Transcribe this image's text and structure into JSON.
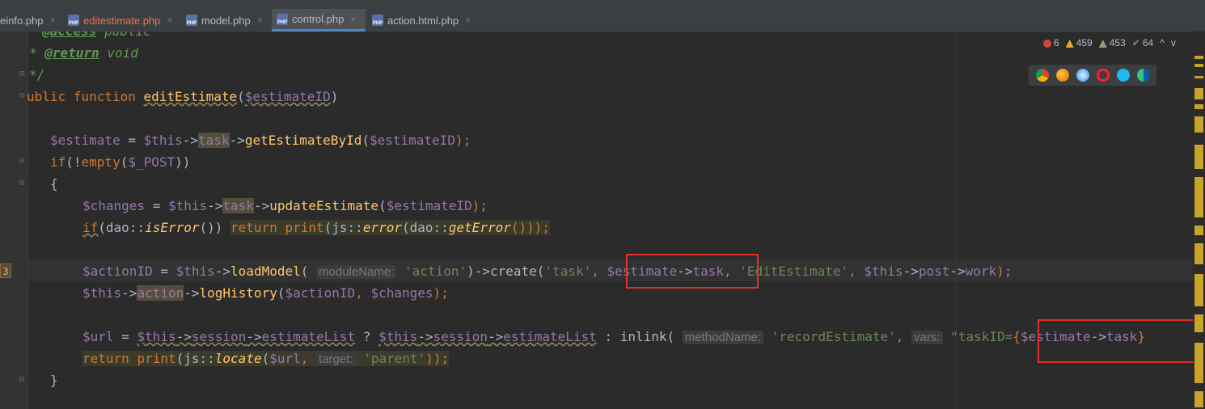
{
  "tabs": [
    {
      "label": "einfo.php",
      "modified": false,
      "active": false
    },
    {
      "label": "editestimate.php",
      "modified": true,
      "active": false
    },
    {
      "label": "model.php",
      "modified": false,
      "active": false
    },
    {
      "label": "control.php",
      "modified": false,
      "active": true
    },
    {
      "label": "action.html.php",
      "modified": false,
      "active": false
    }
  ],
  "tab_icon_text": "PHP",
  "tab_close": "×",
  "inspections": {
    "errors": "6",
    "warnings": "459",
    "weak_warnings": "453",
    "typos": "64",
    "up": "^",
    "down": "v"
  },
  "gutter_line_number": "3",
  "code": {
    "l1_tag": "@access",
    "l1_val": " public",
    "l2_star": "* ",
    "l2_tag": "@return",
    "l2_val": " void",
    "l3": "*/",
    "l4_kw": "ublic function ",
    "l4_fn": "editEstimate",
    "l4_open": "(",
    "l4_var": "$estimateID",
    "l4_close": ")",
    "l6": [
      "$estimate",
      " = ",
      "$this",
      "->",
      "task",
      "->",
      "getEstimateById",
      "(",
      "$estimateID",
      ");"
    ],
    "l7": [
      "if",
      "(!",
      "empty",
      "(",
      "$_POST",
      "))"
    ],
    "l8": "{",
    "l9": [
      "$changes",
      " = ",
      "$this",
      "->",
      "task",
      "->",
      "updateEstimate",
      "(",
      "$estimateID",
      ");"
    ],
    "l10": [
      "if",
      "(dao::",
      "isError",
      "()) ",
      "return",
      " ",
      "print",
      "(js::",
      "error",
      "(dao::",
      "getError",
      "()));"
    ],
    "l12": [
      "$actionID",
      " = ",
      "$this",
      "->",
      "loadModel",
      "( ",
      "moduleName:",
      " ",
      "'action'",
      ")->create(",
      "'task'",
      ", ",
      "$estimate",
      "->",
      "task",
      ", ",
      "'EditEstimate'",
      ", ",
      "$this",
      "->",
      "post",
      "->",
      "work",
      ");"
    ],
    "l13": [
      "$this",
      "->",
      "action",
      "->",
      "logHistory",
      "(",
      "$actionID",
      ", ",
      "$changes",
      ");"
    ],
    "l15": [
      "$url",
      " = ",
      "$this",
      "->",
      "session",
      "->",
      "estimateList",
      " ? ",
      "$this",
      "->",
      "session",
      "->",
      "estimateList",
      " : inlink( ",
      "methodName:",
      " ",
      "'recordEstimate'",
      ", ",
      "vars:",
      " \"taskID=",
      "{",
      "$estimate",
      "->",
      "task",
      "}"
    ],
    "l16": [
      "return",
      " ",
      "print",
      "(js::",
      "locate",
      "(",
      "$url",
      ", ",
      "target:",
      " ",
      "'parent'",
      "));"
    ],
    "l17": "}"
  },
  "browsers": [
    "chrome-icon",
    "firefox-icon",
    "safari-icon",
    "opera-icon",
    "ie-icon",
    "edge-icon"
  ]
}
